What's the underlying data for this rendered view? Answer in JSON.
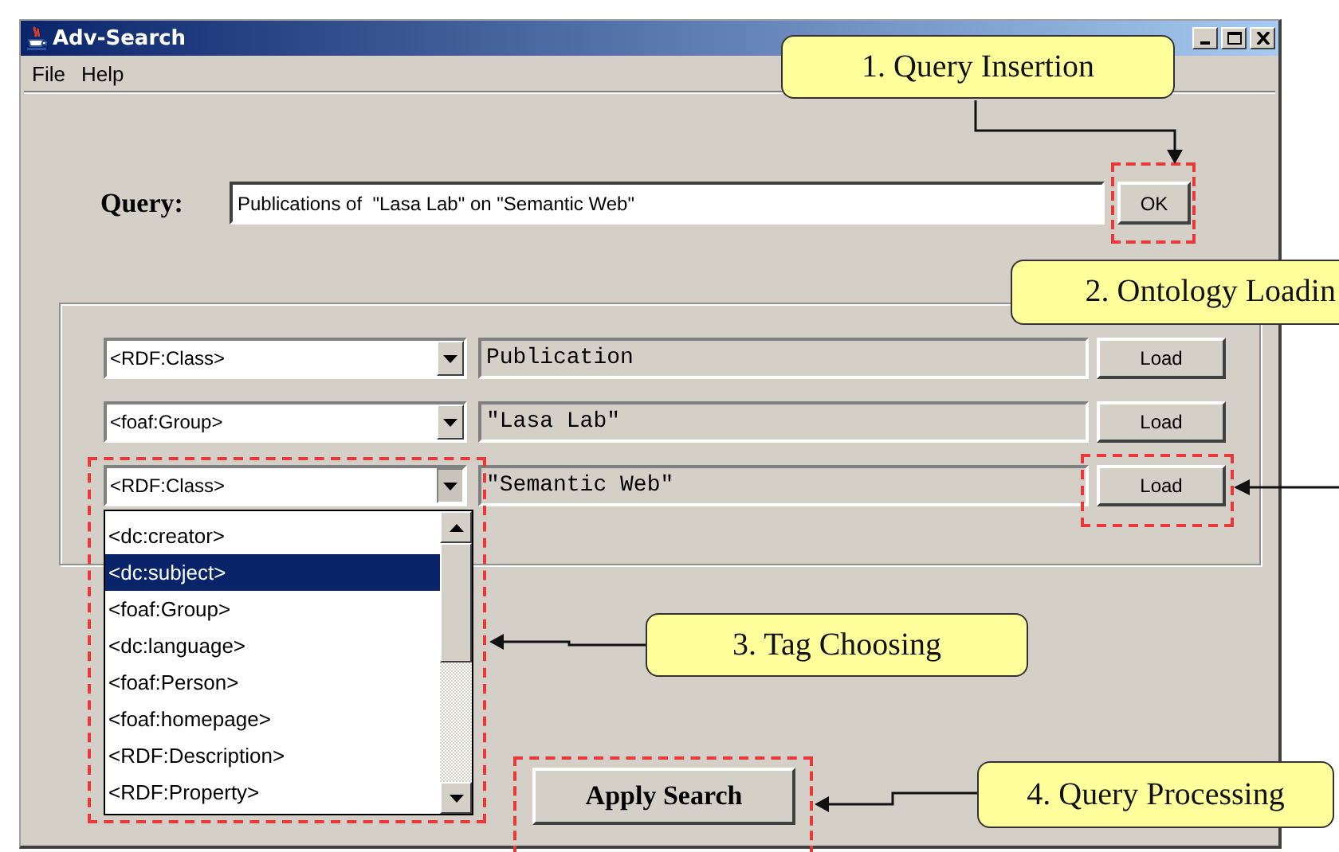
{
  "window": {
    "title": "Adv-Search"
  },
  "menu": [
    {
      "label": "File"
    },
    {
      "label": "Help"
    }
  ],
  "query": {
    "label": "Query:",
    "value": "Publications of  \"Lasa Lab\" on \"Semantic Web\"",
    "button": "OK"
  },
  "tag_rows": [
    {
      "tag": "<RDF:Class>",
      "value": "Publication",
      "button": "Load",
      "expanded": false
    },
    {
      "tag": "<foaf:Group>",
      "value": "\"Lasa Lab\"",
      "button": "Load",
      "expanded": false
    },
    {
      "tag": "<RDF:Class>",
      "value": "\"Semantic Web\"",
      "button": "Load",
      "expanded": true
    }
  ],
  "dropdown": {
    "items": [
      {
        "label": "<dc:creator>",
        "selected": false
      },
      {
        "label": "<dc:subject>",
        "selected": true
      },
      {
        "label": "<foaf:Group>",
        "selected": false
      },
      {
        "label": "<dc:language>",
        "selected": false
      },
      {
        "label": "<foaf:Person>",
        "selected": false
      },
      {
        "label": "<foaf:homepage>",
        "selected": false
      },
      {
        "label": "<RDF:Description>",
        "selected": false
      },
      {
        "label": "<RDF:Property>",
        "selected": false
      }
    ]
  },
  "apply_button": "Apply Search",
  "annotations": [
    {
      "text": "1. Query Insertion"
    },
    {
      "text": "2. Ontology Loadin"
    },
    {
      "text": "3. Tag Choosing"
    },
    {
      "text": "4. Query Processing"
    }
  ]
}
